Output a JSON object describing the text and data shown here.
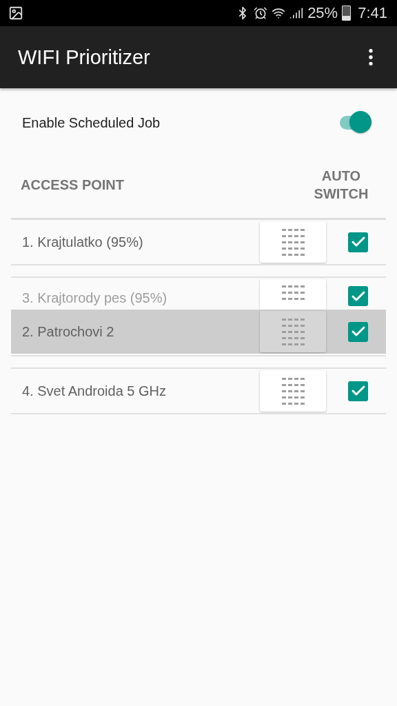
{
  "status_bar": {
    "battery": "25%",
    "time": "7:41"
  },
  "app_bar": {
    "title": "WIFI Prioritizer"
  },
  "scheduled_job": {
    "label": "Enable Scheduled Job",
    "on": true
  },
  "table": {
    "columns": [
      "ACCESS POINT",
      "AUTO SWITCH"
    ],
    "rows": [
      {
        "label": "1. Krajtulatko (95%)",
        "auto_switch": true,
        "dragging": false
      },
      {
        "label": "3. Krajtorody pes (95%)",
        "auto_switch": true,
        "dragging": false
      },
      {
        "label": "2. Patrochovi 2",
        "auto_switch": true,
        "dragging": true
      },
      {
        "label": "4. Svet Androida 5 GHz",
        "auto_switch": true,
        "dragging": false
      }
    ]
  }
}
